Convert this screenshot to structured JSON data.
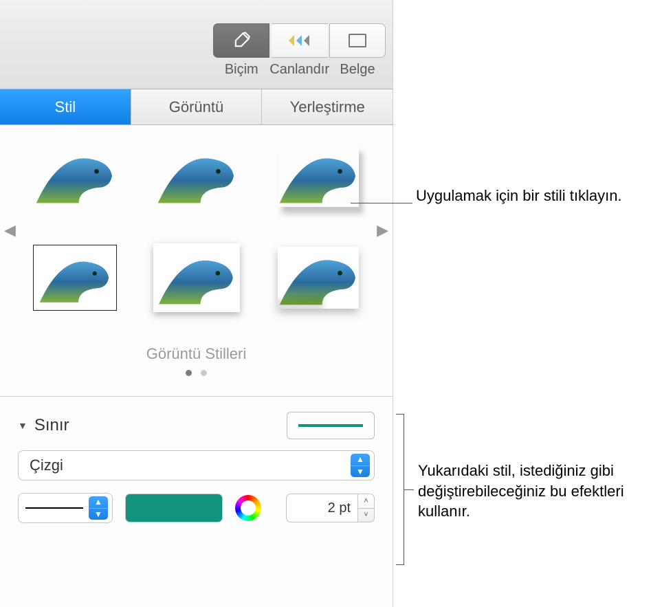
{
  "toolbar": {
    "format": "Biçim",
    "animate": "Canlandır",
    "document": "Belge"
  },
  "tabs": {
    "style": "Stil",
    "image": "Görüntü",
    "arrange": "Yerleştirme"
  },
  "styles_caption": "Görüntü Stilleri",
  "border": {
    "title": "Sınır",
    "type": "Çizgi",
    "width": "2 pt",
    "color": "#12937f"
  },
  "callouts": {
    "click_style": "Uygulamak için bir stili tıklayın.",
    "effects_note": "Yukarıdaki stil, istediğiniz gibi değiştirebileceğiniz bu efektleri kullanır."
  }
}
